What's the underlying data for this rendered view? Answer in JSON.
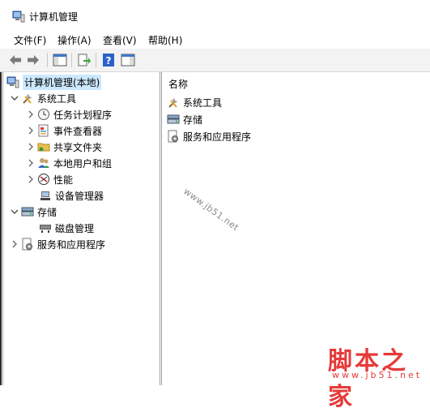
{
  "window": {
    "title": "计算机管理"
  },
  "menu": [
    {
      "id": "file",
      "label": "文件(F)"
    },
    {
      "id": "action",
      "label": "操作(A)"
    },
    {
      "id": "view",
      "label": "查看(V)"
    },
    {
      "id": "help",
      "label": "帮助(H)"
    }
  ],
  "toolbar": {
    "icons": [
      "back-icon",
      "forward-icon",
      "show-hide-tree-icon",
      "export-list-icon",
      "help-icon",
      "show-hide-action-pane-icon"
    ]
  },
  "tree": {
    "root": "计算机管理(本地)",
    "system_tools": "系统工具",
    "task_scheduler": "任务计划程序",
    "event_viewer": "事件查看器",
    "shared_folders": "共享文件夹",
    "local_users": "本地用户和组",
    "performance": "性能",
    "device_manager": "设备管理器",
    "storage": "存储",
    "disk_management": "磁盘管理",
    "services_apps": "服务和应用程序"
  },
  "list": {
    "column_name": "名称",
    "items": [
      "系统工具",
      "存储",
      "服务和应用程序"
    ]
  },
  "watermark": "www.jb51.net",
  "brand": {
    "cn": "脚本之家",
    "url": "www.jb51.net"
  },
  "colors": {
    "selection": "#cce8ff",
    "brand_red": "#e63a3a"
  }
}
